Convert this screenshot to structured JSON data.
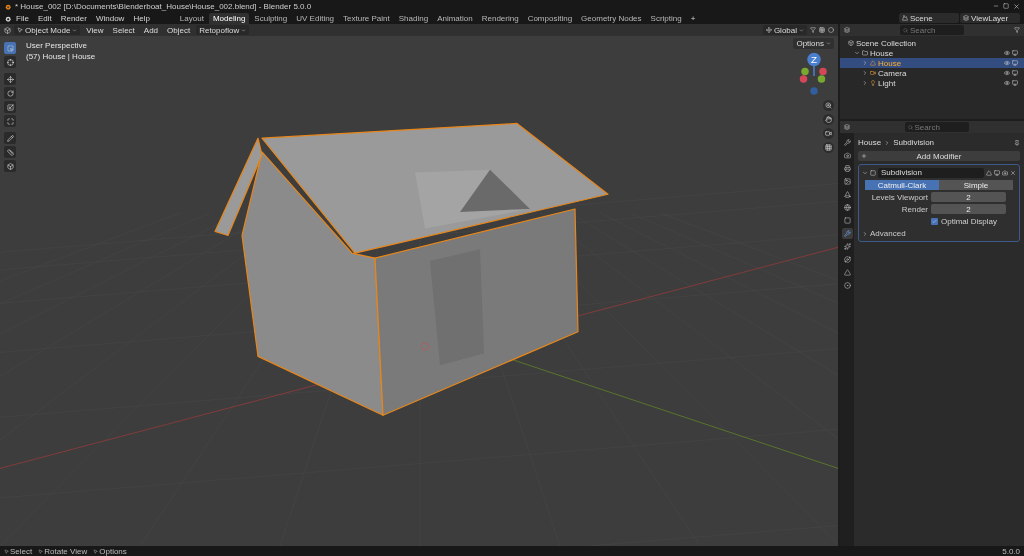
{
  "window": {
    "title": "* House_002 [D:\\Documents\\Blenderboat_House\\House_002.blend] - Blender 5.0.0"
  },
  "menu": [
    "File",
    "Edit",
    "Render",
    "Window",
    "Help"
  ],
  "workspaces": [
    {
      "label": "Layout",
      "selected": false
    },
    {
      "label": "Modeling",
      "selected": true
    },
    {
      "label": "Sculpting",
      "selected": false
    },
    {
      "label": "UV Editing",
      "selected": false
    },
    {
      "label": "Texture Paint",
      "selected": false
    },
    {
      "label": "Shading",
      "selected": false
    },
    {
      "label": "Animation",
      "selected": false
    },
    {
      "label": "Rendering",
      "selected": false
    },
    {
      "label": "Compositing",
      "selected": false
    },
    {
      "label": "Geometry Nodes",
      "selected": false
    },
    {
      "label": "Scripting",
      "selected": false
    }
  ],
  "add_workspace": "+",
  "scene": {
    "value": "Scene"
  },
  "view_layer": {
    "value": "ViewLayer"
  },
  "viewport": {
    "mode": "Object Mode",
    "menus": [
      "View",
      "Select",
      "Add",
      "Object"
    ],
    "addon_menu": "Retopoflow",
    "orientation": "Global",
    "overlay_text": [
      "User Perspective",
      "(57) House | House"
    ],
    "options": "Options",
    "gizmo_label": "Z",
    "tools": [
      {
        "kind": "select",
        "selected": true
      },
      {
        "kind": "cursor",
        "selected": false
      },
      {
        "kind": "move",
        "selected": false
      },
      {
        "kind": "rotate",
        "selected": false
      },
      {
        "kind": "scale",
        "selected": false
      },
      {
        "kind": "transform",
        "selected": false
      },
      {
        "kind": "annotate",
        "selected": false
      },
      {
        "kind": "measure",
        "selected": false
      },
      {
        "kind": "add",
        "selected": false
      }
    ]
  },
  "outliner": {
    "search": {
      "placeholder": "Search"
    },
    "scene_collection": {
      "label": "Scene Collection",
      "children": [
        {
          "label": "House",
          "kind": "collection",
          "selected": false,
          "expanded": true,
          "children": [
            {
              "label": "House",
              "kind": "mesh",
              "selected": true,
              "expanded": false
            },
            {
              "label": "Camera",
              "kind": "camera",
              "selected": false,
              "expanded": false
            },
            {
              "label": "Light",
              "kind": "light",
              "selected": false,
              "expanded": false
            }
          ]
        }
      ]
    }
  },
  "properties": {
    "search": {
      "placeholder": "Search"
    },
    "tabs": [
      {
        "kind": "tool",
        "selected": false
      },
      {
        "kind": "render",
        "selected": false
      },
      {
        "kind": "output",
        "selected": false
      },
      {
        "kind": "view",
        "selected": false
      },
      {
        "kind": "scene",
        "selected": false
      },
      {
        "kind": "world",
        "selected": false
      },
      {
        "kind": "object",
        "selected": false
      },
      {
        "kind": "modifiers",
        "selected": true
      },
      {
        "kind": "particles",
        "selected": false
      },
      {
        "kind": "physics",
        "selected": false
      },
      {
        "kind": "data",
        "selected": false
      },
      {
        "kind": "material",
        "selected": false
      }
    ],
    "breadcrumb": [
      "House",
      "Subdivision"
    ],
    "add_modifier": "Add Modifier",
    "modifier": {
      "name": "Subdivision",
      "expanded": true,
      "types": [
        {
          "label": "Catmull-Clark",
          "selected": true
        },
        {
          "label": "Simple",
          "selected": false
        }
      ],
      "fields": [
        {
          "label": "Levels Viewport",
          "value": "2"
        },
        {
          "label": "Render",
          "value": "2"
        }
      ],
      "optimal_display": {
        "label": "Optimal Display",
        "checked": true
      },
      "advanced": {
        "label": "Advanced",
        "expanded": false
      }
    }
  },
  "status_bar": {
    "hints": [
      "Select",
      "Rotate View",
      "Options"
    ],
    "version": "5.0.0"
  }
}
